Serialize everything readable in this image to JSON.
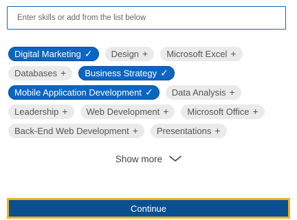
{
  "search": {
    "placeholder": "Enter skills or add from the list below"
  },
  "skills": {
    "rows": [
      [
        {
          "label": "Digital Marketing",
          "selected": true
        },
        {
          "label": "Design",
          "selected": false
        },
        {
          "label": "Microsoft Excel",
          "selected": false
        }
      ],
      [
        {
          "label": "Databases",
          "selected": false
        },
        {
          "label": "Business Strategy",
          "selected": true
        }
      ],
      [
        {
          "label": "Mobile Application Development",
          "selected": true
        },
        {
          "label": "Data Analysis",
          "selected": false
        }
      ],
      [
        {
          "label": "Leadership",
          "selected": false
        },
        {
          "label": "Web Development",
          "selected": false
        },
        {
          "label": "Microsoft Office",
          "selected": false
        }
      ],
      [
        {
          "label": "Back-End Web Development",
          "selected": false
        },
        {
          "label": "Presentations",
          "selected": false
        }
      ]
    ],
    "selected_symbol": "✓",
    "unselected_symbol": "+"
  },
  "show_more": {
    "label": "Show more",
    "icon": "chevron-down-icon"
  },
  "continue_button": {
    "label": "Continue"
  },
  "colors": {
    "accent": "#0a66c2",
    "continue_bg": "#0a5090",
    "focus_outline": "#f2b21b",
    "chip_off_bg": "#eaeaea"
  }
}
